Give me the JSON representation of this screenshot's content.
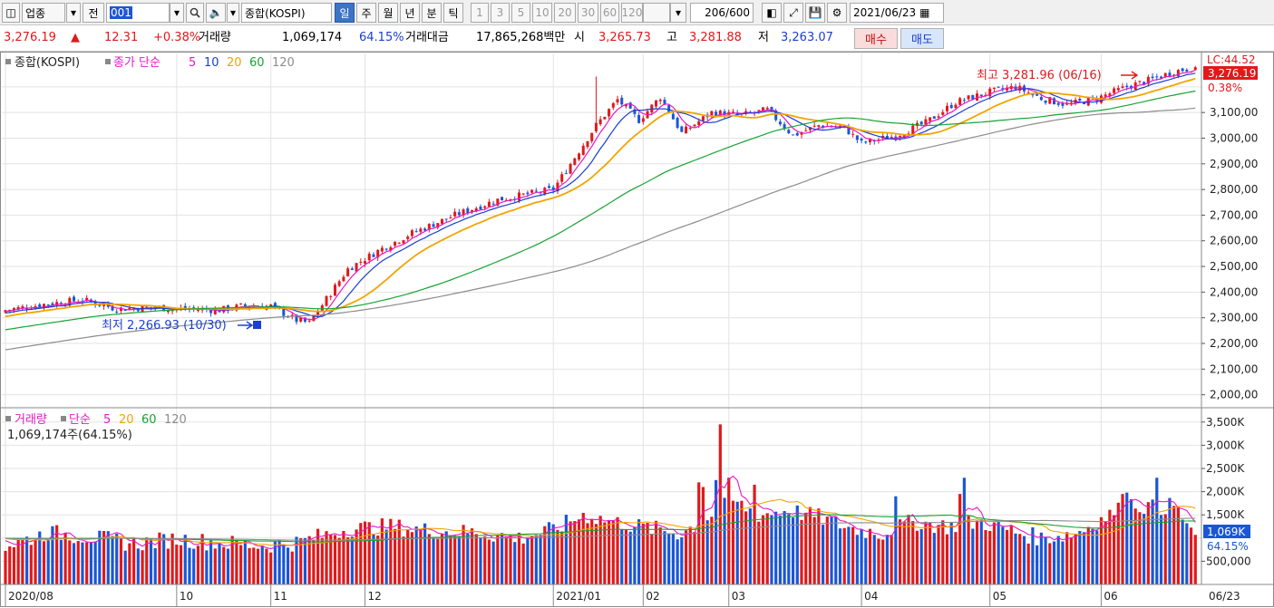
{
  "toolbar": {
    "market_select": "업종",
    "jeon_label": "전",
    "code_value": "001",
    "index_name": "종합(KOSPI)",
    "periods": [
      "일",
      "주",
      "월",
      "년",
      "분",
      "틱"
    ],
    "active_period": "일",
    "intervals": [
      "1",
      "3",
      "5",
      "10",
      "20",
      "30",
      "60",
      "120"
    ],
    "count_value": "206",
    "count_total": "/600",
    "date_value": "2021/06/23"
  },
  "quote": {
    "price": "3,276.19",
    "up_arrow": "▲",
    "change": "12.31",
    "change_pct": "+0.38%",
    "volume_label": "거래량",
    "volume": "1,069,174",
    "volume_pct": "64.15%",
    "amount_label": "거래대금",
    "amount": "17,865,268백만",
    "open_label": "시",
    "open": "3,265.73",
    "high_label": "고",
    "high": "3,281.88",
    "low_label": "저",
    "low": "3,263.07",
    "buy_label": "매수",
    "sell_label": "매도"
  },
  "price_legend": {
    "title": "종합(KOSPI)",
    "ma_label": "종가 단순",
    "periods": [
      "5",
      "10",
      "20",
      "60",
      "120"
    ]
  },
  "volume_legend": {
    "title": "거래량",
    "ma_label": "단순",
    "periods": [
      "5",
      "20",
      "60",
      "120"
    ],
    "current": "1,069,174주(64.15%)"
  },
  "annotations": {
    "max_label": "최고 3,281.96 (06/16)",
    "min_label": "최저 2,266.93 (10/30)",
    "lc_label": "LC:44.52",
    "current_price": "3,276.19",
    "current_pct": "0.38%",
    "vol_current": "1,069K",
    "vol_pct": "64.15%"
  },
  "colors": {
    "up": "#e0191b",
    "down": "#1a56d6",
    "ma5": "#e619c8",
    "ma10": "#1a3fd0",
    "ma20": "#f2a400",
    "ma60": "#17a334",
    "ma120": "#8c8c8c",
    "grid": "#e3e3e3"
  },
  "chart_data": {
    "type": "candlestick",
    "title": "종합(KOSPI)",
    "x_labels": [
      "2020/08",
      "10",
      "11",
      "12",
      "2021/01",
      "02",
      "03",
      "04",
      "05",
      "06",
      "06/23"
    ],
    "y_ticks": [
      "3,100,00",
      "3,000,00",
      "2,900,00",
      "2,800,00",
      "2,700,00",
      "2,600,00",
      "2,500,00",
      "2,400,00",
      "2,300,00",
      "2,200,00",
      "2,100,00",
      "2,000,00"
    ],
    "ylim": [
      1960,
      3330
    ],
    "volume_ticks": [
      "3,500K",
      "3,000K",
      "2,500K",
      "2,000K",
      "1,500K",
      "500,000"
    ],
    "volume_ylim": [
      0,
      3750
    ],
    "close_anchors": [
      [
        0,
        2330
      ],
      [
        10,
        2355
      ],
      [
        18,
        2370
      ],
      [
        26,
        2335
      ],
      [
        34,
        2340
      ],
      [
        40,
        2335
      ],
      [
        50,
        2330
      ],
      [
        55,
        2345
      ],
      [
        62,
        2345
      ],
      [
        68,
        2290
      ],
      [
        71,
        2280
      ],
      [
        80,
        2490
      ],
      [
        88,
        2570
      ],
      [
        95,
        2630
      ],
      [
        105,
        2700
      ],
      [
        115,
        2760
      ],
      [
        128,
        2800
      ],
      [
        138,
        3050
      ],
      [
        143,
        3150
      ],
      [
        148,
        3070
      ],
      [
        153,
        3160
      ],
      [
        158,
        3020
      ],
      [
        165,
        3100
      ],
      [
        172,
        3090
      ],
      [
        178,
        3110
      ],
      [
        184,
        3010
      ],
      [
        190,
        3050
      ],
      [
        196,
        3040
      ],
      [
        200,
        2980
      ],
      [
        208,
        3010
      ],
      [
        215,
        3060
      ],
      [
        222,
        3140
      ],
      [
        230,
        3180
      ],
      [
        236,
        3200
      ],
      [
        242,
        3155
      ],
      [
        248,
        3130
      ],
      [
        255,
        3155
      ],
      [
        262,
        3200
      ],
      [
        268,
        3230
      ],
      [
        273,
        3260
      ],
      [
        278,
        3276
      ]
    ],
    "vol_anchors": [
      [
        0,
        820
      ],
      [
        10,
        1120
      ],
      [
        20,
        1020
      ],
      [
        30,
        880
      ],
      [
        40,
        980
      ],
      [
        50,
        900
      ],
      [
        60,
        840
      ],
      [
        68,
        900
      ],
      [
        72,
        1000
      ],
      [
        80,
        1200
      ],
      [
        90,
        1250
      ],
      [
        100,
        1150
      ],
      [
        110,
        1120
      ],
      [
        120,
        1000
      ],
      [
        128,
        1180
      ],
      [
        135,
        1500
      ],
      [
        142,
        1350
      ],
      [
        148,
        1250
      ],
      [
        158,
        1100
      ],
      [
        165,
        1500
      ],
      [
        170,
        1800
      ],
      [
        176,
        1500
      ],
      [
        183,
        1600
      ],
      [
        190,
        1450
      ],
      [
        198,
        1200
      ],
      [
        205,
        1100
      ],
      [
        212,
        1350
      ],
      [
        220,
        1250
      ],
      [
        228,
        1350
      ],
      [
        235,
        1150
      ],
      [
        242,
        1000
      ],
      [
        250,
        1100
      ],
      [
        258,
        1500
      ],
      [
        263,
        1750
      ],
      [
        268,
        1650
      ],
      [
        273,
        1700
      ],
      [
        278,
        1069
      ]
    ],
    "vol_spikes": [
      [
        162,
        2200
      ],
      [
        163,
        2100
      ],
      [
        166,
        2250
      ],
      [
        167,
        3450
      ],
      [
        169,
        2300
      ],
      [
        175,
        2150
      ],
      [
        208,
        1900
      ],
      [
        223,
        1950
      ],
      [
        224,
        2300
      ],
      [
        269,
        2300
      ],
      [
        261,
        1950
      ],
      [
        262,
        1980
      ]
    ],
    "ma_periods": [
      5,
      10,
      20,
      60,
      120
    ]
  }
}
